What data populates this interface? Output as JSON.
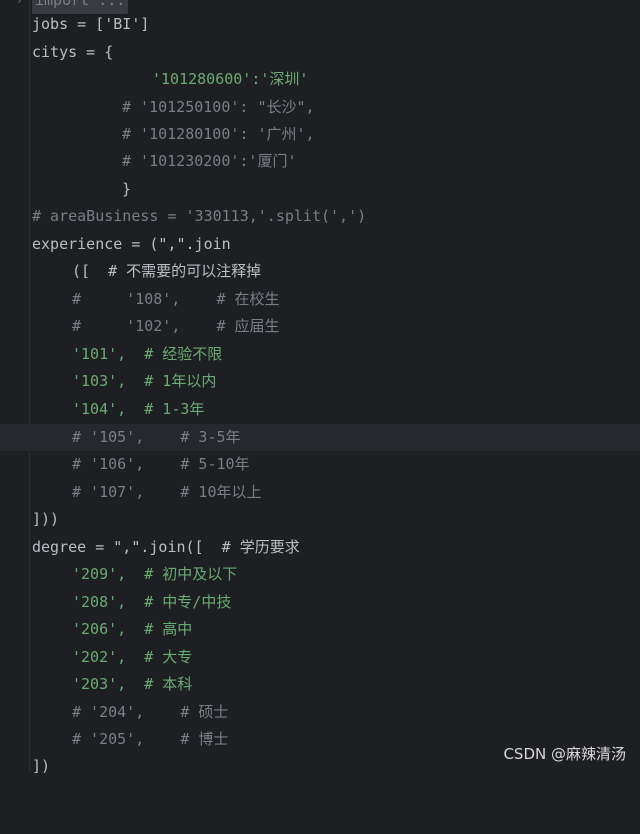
{
  "editor": {
    "lines": [
      {
        "text": "import ...",
        "kind": "folded"
      },
      {
        "text": "jobs = ['BI']"
      },
      {
        "text": "citys = {"
      },
      {
        "text": "'101280600':'深圳'",
        "kind": "string"
      },
      {
        "text": "# '101250100': \"长沙\",",
        "kind": "comment"
      },
      {
        "text": "# '101280100': '广州',",
        "kind": "comment"
      },
      {
        "text": "# '101230200':'厦门'",
        "kind": "comment"
      },
      {
        "text": "}"
      },
      {
        "text": "# areaBusiness = '330113,'.split(',')",
        "kind": "comment"
      },
      {
        "text": "experience = (\",\".join"
      },
      {
        "text": "([  # 不需要的可以注释掉",
        "kind": "mixed"
      },
      {
        "text": "#     '108',    # 在校生",
        "kind": "comment"
      },
      {
        "text": "#     '102',    # 应届生",
        "kind": "comment"
      },
      {
        "text": "'101',  # 经验不限",
        "kind": "mixed"
      },
      {
        "text": "'103',  # 1年以内",
        "kind": "mixed"
      },
      {
        "text": "'104',  # 1-3年",
        "kind": "mixed"
      },
      {
        "text": "# '105',    # 3-5年",
        "kind": "comment"
      },
      {
        "text": "# '106',    # 5-10年",
        "kind": "comment"
      },
      {
        "text": "# '107',    # 10年以上",
        "kind": "comment"
      },
      {
        "text": "]))"
      },
      {
        "text": "degree = \",\".join([  # 学历要求",
        "kind": "mixed"
      },
      {
        "text": "'209',  # 初中及以下",
        "kind": "mixed"
      },
      {
        "text": "'208',  # 中专/中技",
        "kind": "mixed"
      },
      {
        "text": "'206',  # 高中",
        "kind": "mixed"
      },
      {
        "text": "'202',  # 大专",
        "kind": "mixed"
      },
      {
        "text": "'203',  # 本科",
        "kind": "mixed"
      },
      {
        "text": "# '204',    # 硕士",
        "kind": "comment"
      },
      {
        "text": "# '205',    # 博士",
        "kind": "comment"
      },
      {
        "text": "])"
      }
    ]
  },
  "watermark": "CSDN @麻辣清汤",
  "colors": {
    "background": "#1e1f22",
    "string": "#6aab73",
    "comment": "#7a7e85",
    "text": "#bcbec4",
    "current_line": "#26282e"
  }
}
